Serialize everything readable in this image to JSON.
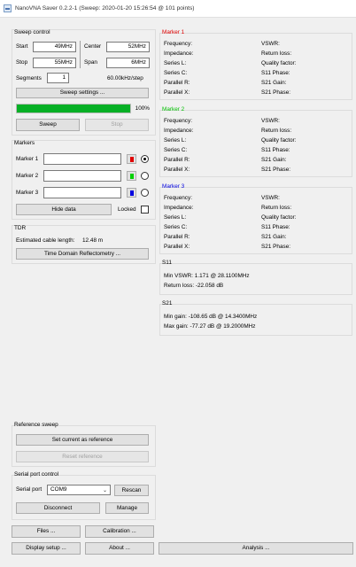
{
  "window": {
    "title": "NanoVNA Saver 0.2.2-1 (Sweep: 2020-01-20 15:26:54 @ 101 points)"
  },
  "sweep_control": {
    "title": "Sweep control",
    "start_label": "Start",
    "start_value": "49MHz",
    "center_label": "Center",
    "center_value": "52MHz",
    "stop_label": "Stop",
    "stop_value": "55MHz",
    "span_label": "Span",
    "span_value": "6MHz",
    "segments_label": "Segments",
    "segments_value": "1",
    "step_text": "60.00kHz/step",
    "settings_button": "Sweep settings ...",
    "progress_percent": 100,
    "progress_text": "100%",
    "sweep_button": "Sweep",
    "stop_button": "Stop"
  },
  "markers": {
    "title": "Markers",
    "items": [
      {
        "label": "Marker 1",
        "value": "",
        "color": "#e00000",
        "selected": true
      },
      {
        "label": "Marker 2",
        "value": "",
        "color": "#00d000",
        "selected": false
      },
      {
        "label": "Marker 3",
        "value": "",
        "color": "#0000e0",
        "selected": false
      }
    ],
    "hide_button": "Hide data",
    "locked_label": "Locked"
  },
  "tdr": {
    "title": "TDR",
    "cable_label": "Estimated cable length:",
    "cable_value": "12.48 m",
    "button": "Time Domain Reflectometry ..."
  },
  "reference_sweep": {
    "title": "Reference sweep",
    "set_button": "Set current as reference",
    "reset_button": "Reset reference"
  },
  "serial": {
    "title": "Serial port control",
    "port_label": "Serial port",
    "port_value": "COM9",
    "rescan_button": "Rescan",
    "disconnect_button": "Disconnect",
    "manage_button": "Manage"
  },
  "bottom_buttons": {
    "files": "Files ...",
    "calibration": "Calibration ...",
    "display_setup": "Display setup ...",
    "about": "About ...",
    "analysis": "Analysis ..."
  },
  "marker_panels": [
    {
      "title": "Marker 1",
      "title_color": "#e00000",
      "left": [
        "Frequency:",
        "Impedance:",
        "Series L:",
        "Series C:",
        "Parallel R:",
        "Parallel X:"
      ],
      "right": [
        "VSWR:",
        "Return loss:",
        "Quality factor:",
        "S11 Phase:",
        "S21 Gain:",
        "S21 Phase:"
      ]
    },
    {
      "title": "Marker 2",
      "title_color": "#00c000",
      "left": [
        "Frequency:",
        "Impedance:",
        "Series L:",
        "Series C:",
        "Parallel R:",
        "Parallel X:"
      ],
      "right": [
        "VSWR:",
        "Return loss:",
        "Quality factor:",
        "S11 Phase:",
        "S21 Gain:",
        "S21 Phase:"
      ]
    },
    {
      "title": "Marker 3",
      "title_color": "#0000e0",
      "left": [
        "Frequency:",
        "Impedance:",
        "Series L:",
        "Series C:",
        "Parallel R:",
        "Parallel X:"
      ],
      "right": [
        "VSWR:",
        "Return loss:",
        "Quality factor:",
        "S11 Phase:",
        "S21 Gain:",
        "S21 Phase:"
      ]
    }
  ],
  "s11": {
    "title": "S11",
    "min_vswr": "Min VSWR:   1.171 @ 28.1100MHz",
    "return_loss": "Return loss:  -22.058 dB"
  },
  "s21": {
    "title": "S21",
    "min_gain": "Min gain:  -108.65 dB @ 14.3400MHz",
    "max_gain": "Max gain:  -77.27 dB @ 19.2000MHz"
  }
}
